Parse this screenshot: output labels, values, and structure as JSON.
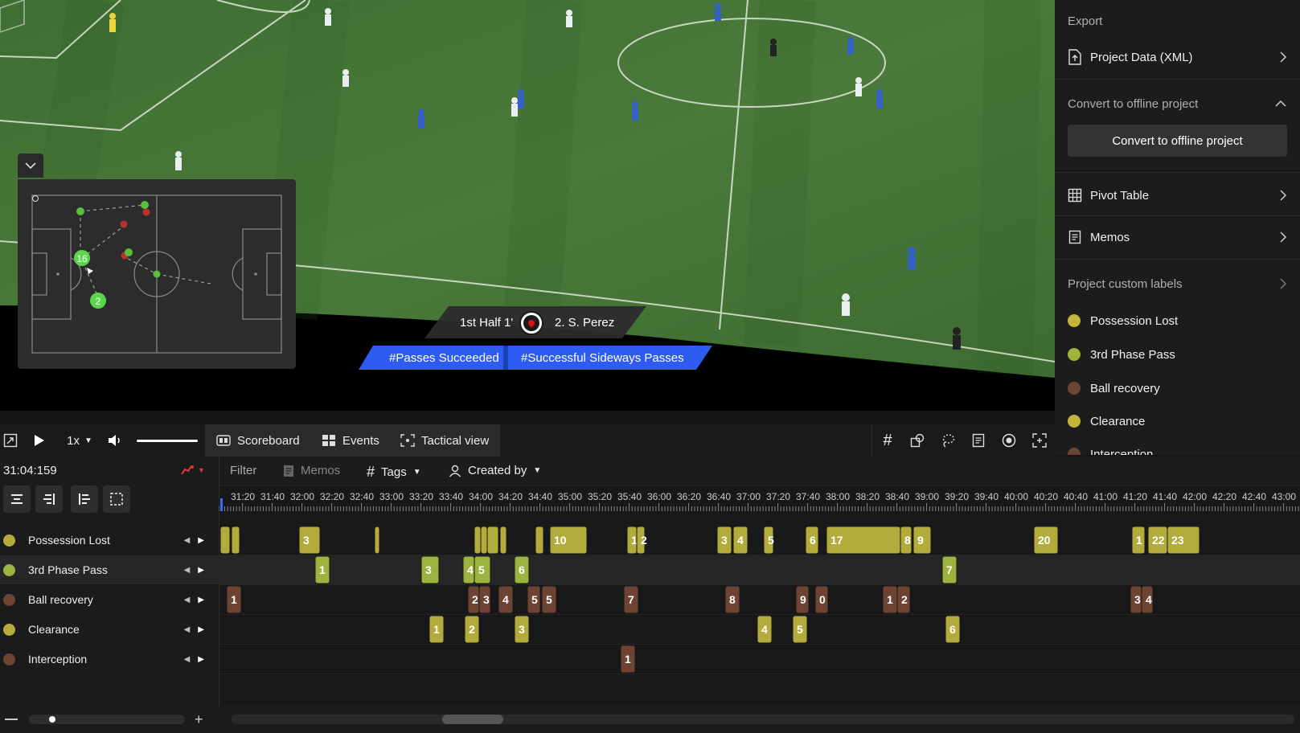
{
  "overlay": {
    "half": "1st Half 1'",
    "player": "2. S. Perez",
    "tags": [
      "#Passes Succeeded",
      "#Successful Sideways Passes"
    ]
  },
  "minimap": {
    "players": [
      "16",
      "2"
    ]
  },
  "right_panel": {
    "export_title": "Export",
    "project_data": "Project Data (XML)",
    "convert_section": "Convert to offline project",
    "convert_button": "Convert to offline project",
    "pivot_table": "Pivot Table",
    "memos": "Memos",
    "custom_labels_title": "Project custom labels",
    "labels": [
      {
        "name": "Possession Lost",
        "color": "#c2b53a"
      },
      {
        "name": "3rd Phase Pass",
        "color": "#9fb43a"
      },
      {
        "name": "Ball recovery",
        "color": "#6b4533"
      },
      {
        "name": "Clearance",
        "color": "#c2b53a"
      },
      {
        "name": "Interception",
        "color": "#6b4533"
      }
    ]
  },
  "controls": {
    "speed": "1x",
    "tabs": [
      "Scoreboard",
      "Events",
      "Tactical view"
    ]
  },
  "timeline": {
    "current_time": "31:04:159",
    "filter": "Filter",
    "memos": "Memos",
    "tags": "Tags",
    "created_by": "Created by",
    "ticks": [
      "31:20",
      "31:40",
      "32:00",
      "32:20",
      "32:40",
      "33:00",
      "33:20",
      "33:40",
      "34:00",
      "34:20",
      "34:40",
      "35:00",
      "35:20",
      "35:40",
      "36:00",
      "36:20",
      "36:40",
      "37:00",
      "37:20",
      "37:40",
      "38:00",
      "38:20",
      "38:40",
      "39:00",
      "39:20",
      "39:40",
      "40:00",
      "40:20",
      "40:40",
      "41:00",
      "41:20",
      "41:40",
      "42:00",
      "42:20",
      "42:40",
      "43:00"
    ],
    "rows": [
      {
        "name": "Possession Lost",
        "color": "#b3ab3c"
      },
      {
        "name": "3rd Phase Pass",
        "color": "#9db33f"
      },
      {
        "name": "Ball recovery",
        "color": "#6d4434"
      },
      {
        "name": "Clearance",
        "color": "#b3ab3c"
      },
      {
        "name": "Interception",
        "color": "#6d4434"
      }
    ]
  }
}
